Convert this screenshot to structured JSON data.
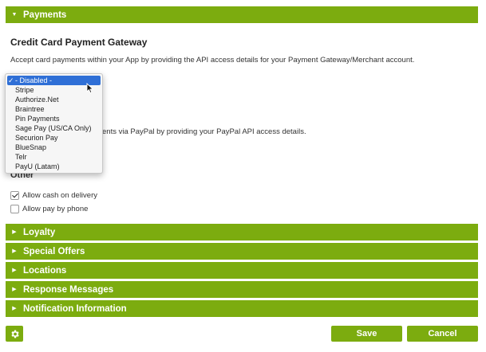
{
  "sections": {
    "payments": "Payments",
    "loyalty": "Loyalty",
    "special_offers": "Special Offers",
    "locations": "Locations",
    "response_messages": "Response Messages",
    "notification_information": "Notification Information"
  },
  "credit_card": {
    "title": "Credit Card Payment Gateway",
    "description": "Accept card payments within your App by providing the API access details for your Payment Gateway/Merchant account."
  },
  "gateway_select": {
    "selected": "- Disabled -",
    "options": [
      "Stripe",
      "Authorize.Net",
      "Braintree",
      "Pin Payments",
      "Sage Pay (US/CA Only)",
      "Securion Pay",
      "BlueSnap",
      "Telr",
      "PayU (Latam)"
    ]
  },
  "paypal": {
    "description_partial": "ents via PayPal by providing your PayPal API access details."
  },
  "other": {
    "title": "Other",
    "cash_on_delivery": "Allow cash on delivery",
    "cash_on_delivery_checked": true,
    "pay_by_phone": "Allow pay by phone",
    "pay_by_phone_checked": false
  },
  "footer": {
    "save_label": "Save",
    "cancel_label": "Cancel",
    "settings_icon": "gear-icon"
  },
  "colors": {
    "accent": "#7cac0f",
    "selection": "#2f6fd6"
  }
}
